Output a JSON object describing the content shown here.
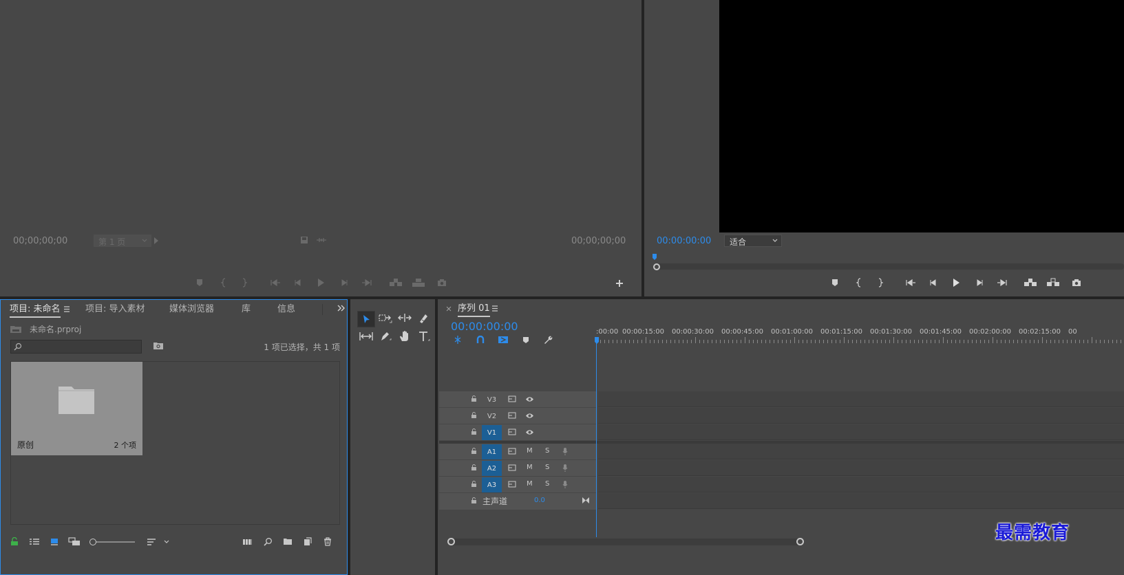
{
  "source_monitor": {
    "timecode_left": "00;00;00;00",
    "page_label": "第 1 页",
    "timecode_right": "00;00;00;00"
  },
  "program_monitor": {
    "timecode": "00:00:00:00",
    "fit_label": "适合"
  },
  "project_panel": {
    "tabs": [
      "项目: 未命名",
      "项目: 导入素材",
      "媒体浏览器",
      "库",
      "信息"
    ],
    "file_name": "未命名.prproj",
    "selection_status": "1 项已选择，共 1 项",
    "search_placeholder": "",
    "bin": {
      "name": "原创",
      "count": "2 个项"
    }
  },
  "timeline": {
    "sequence_name": "序列 01",
    "timecode": "00:00:00:00",
    "ruler_labels": [
      ":00:00",
      "00:00:15:00",
      "00:00:30:00",
      "00:00:45:00",
      "00:01:00:00",
      "00:01:15:00",
      "00:01:30:00",
      "00:01:45:00",
      "00:02:00:00",
      "00:02:15:00",
      "00"
    ],
    "video_tracks": [
      "V3",
      "V2",
      "V1"
    ],
    "audio_tracks": [
      "A1",
      "A2",
      "A3"
    ],
    "mute_label": "M",
    "solo_label": "S",
    "master_label": "主声道",
    "master_value": "0.0"
  },
  "watermark": "最需教育",
  "colors": {
    "panel_bg": "#474747",
    "accent_blue": "#2d8ceb",
    "track_target_blue": "#1c5f95",
    "frame_bg": "#232323"
  }
}
